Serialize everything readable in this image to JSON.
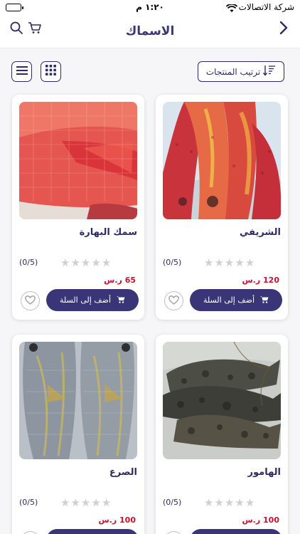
{
  "status_bar": {
    "carrier": "شركة الاتصالات",
    "time": "١:٢٠ م"
  },
  "header": {
    "title": "الاسماك",
    "back_icon": "chevron-right-icon",
    "cart_icon": "cart-icon",
    "search_icon": "search-icon"
  },
  "toolbar": {
    "sort_label": "ترتيب المنتجات",
    "sort_icon": "sort-icon",
    "grid_icon": "grid-view-icon",
    "list_icon": "list-view-icon"
  },
  "cart_label": "أضف إلى السلة",
  "colors": {
    "primary": "#3a3576",
    "price": "#c4122f",
    "star_empty": "#cfcfd4"
  },
  "products": [
    {
      "name": "الشريفي",
      "rating": "(0/5)",
      "price": "120 ر.س"
    },
    {
      "name": "سمك البهارة",
      "rating": "(0/5)",
      "price": "65 ر.س"
    },
    {
      "name": "الهامور",
      "rating": "(0/5)",
      "price": "100 ر.س"
    },
    {
      "name": "الصرع",
      "rating": "(0/5)",
      "price": "100 ر.س"
    }
  ]
}
